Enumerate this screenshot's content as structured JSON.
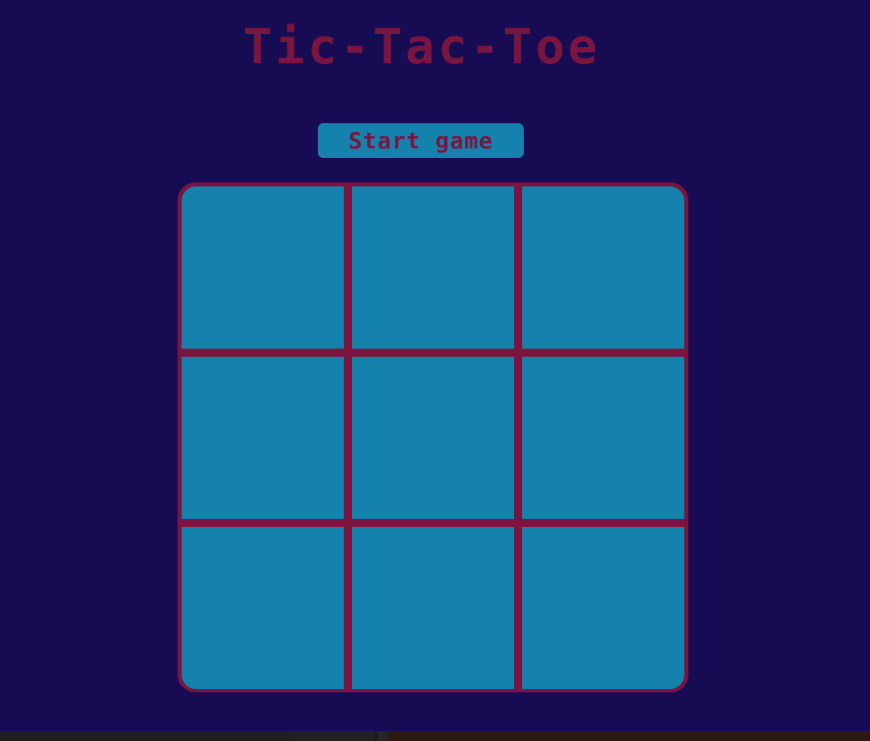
{
  "game": {
    "title": "Tic-Tac-Toe",
    "start_button_label": "Start game",
    "board": {
      "rows": 3,
      "cols": 3,
      "cells": [
        "",
        "",
        "",
        "",
        "",
        "",
        "",
        "",
        ""
      ]
    }
  },
  "colors": {
    "background": "#170c54",
    "accent": "#7b1540",
    "cell": "#1582ad"
  }
}
